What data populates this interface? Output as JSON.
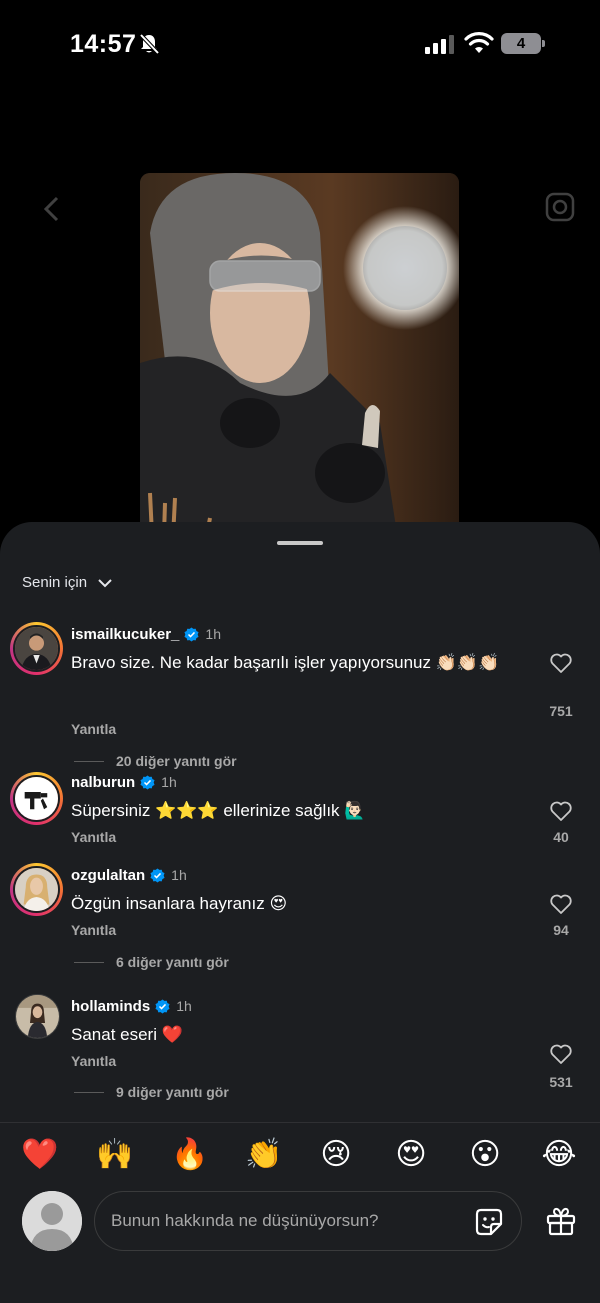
{
  "status_bar": {
    "time": "14:57",
    "battery": "4"
  },
  "filter": {
    "label": "Senin için"
  },
  "comments": [
    {
      "username": "ismailkucuker_",
      "time": "1h",
      "text": "Bravo size. Ne kadar başarılı işler yapıyorsunuz 👏🏻👏🏻👏🏻",
      "reply": "Yanıtla",
      "likes": "751",
      "more_replies": "20 diğer yanıtı gör"
    },
    {
      "username": "nalburun",
      "time": "1h",
      "text": "Süpersiniz ⭐⭐⭐ ellerinize sağlık 🙋🏻‍♂️",
      "reply": "Yanıtla",
      "likes": "40"
    },
    {
      "username": "ozgulaltan",
      "time": "1h",
      "text": "Özgün insanlara hayranız 😍",
      "reply": "Yanıtla",
      "likes": "94",
      "more_replies": "6 diğer yanıtı gör"
    },
    {
      "username": "hollaminds",
      "time": "1h",
      "text": "Sanat eseri ❤️",
      "reply": "Yanıtla",
      "likes": "531",
      "more_replies": "9 diğer yanıtı gör"
    }
  ],
  "reactions": [
    "❤️",
    "🙌",
    "🔥",
    "👏",
    "😢",
    "😍",
    "😮",
    "😂"
  ],
  "composer": {
    "placeholder": "Bunun hakkında ne düşünüyorsun?"
  },
  "icons": {
    "mute": "bell-slash-icon",
    "sound": "speaker-icon",
    "like": "heart-outline-icon",
    "sticker": "sticker-icon",
    "gift": "gift-icon",
    "verified": "verified-badge-icon"
  },
  "colors": {
    "verified": "#0095f6",
    "sheet": "#1c1e21",
    "secondary_text": "#a8a8a8"
  }
}
